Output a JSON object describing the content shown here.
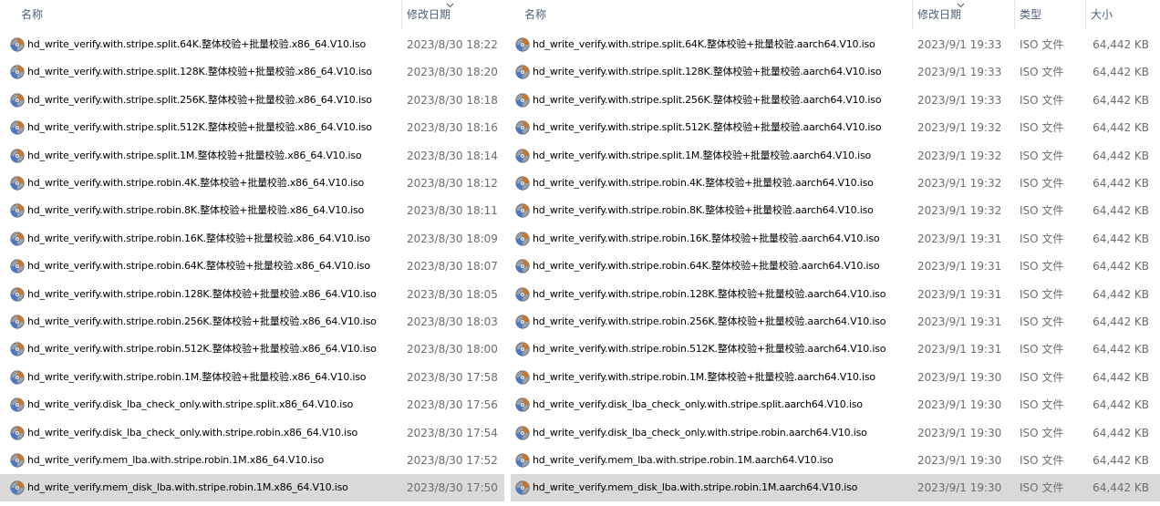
{
  "left_pane": {
    "headers": {
      "name": "名称",
      "modified": "修改日期"
    },
    "rows": [
      {
        "name": "hd_write_verify.with.stripe.split.64K.整体校验+批量校验.x86_64.V10.iso",
        "modified": "2023/8/30 18:22"
      },
      {
        "name": "hd_write_verify.with.stripe.split.128K.整体校验+批量校验.x86_64.V10.iso",
        "modified": "2023/8/30 18:20"
      },
      {
        "name": "hd_write_verify.with.stripe.split.256K.整体校验+批量校验.x86_64.V10.iso",
        "modified": "2023/8/30 18:18"
      },
      {
        "name": "hd_write_verify.with.stripe.split.512K.整体校验+批量校验.x86_64.V10.iso",
        "modified": "2023/8/30 18:16"
      },
      {
        "name": "hd_write_verify.with.stripe.split.1M.整体校验+批量校验.x86_64.V10.iso",
        "modified": "2023/8/30 18:14"
      },
      {
        "name": "hd_write_verify.with.stripe.robin.4K.整体校验+批量校验.x86_64.V10.iso",
        "modified": "2023/8/30 18:12"
      },
      {
        "name": "hd_write_verify.with.stripe.robin.8K.整体校验+批量校验.x86_64.V10.iso",
        "modified": "2023/8/30 18:11"
      },
      {
        "name": "hd_write_verify.with.stripe.robin.16K.整体校验+批量校验.x86_64.V10.iso",
        "modified": "2023/8/30 18:09"
      },
      {
        "name": "hd_write_verify.with.stripe.robin.64K.整体校验+批量校验.x86_64.V10.iso",
        "modified": "2023/8/30 18:07"
      },
      {
        "name": "hd_write_verify.with.stripe.robin.128K.整体校验+批量校验.x86_64.V10.iso",
        "modified": "2023/8/30 18:05"
      },
      {
        "name": "hd_write_verify.with.stripe.robin.256K.整体校验+批量校验.x86_64.V10.iso",
        "modified": "2023/8/30 18:03"
      },
      {
        "name": "hd_write_verify.with.stripe.robin.512K.整体校验+批量校验.x86_64.V10.iso",
        "modified": "2023/8/30 18:00"
      },
      {
        "name": "hd_write_verify.with.stripe.robin.1M.整体校验+批量校验.x86_64.V10.iso",
        "modified": "2023/8/30 17:58"
      },
      {
        "name": "hd_write_verify.disk_lba_check_only.with.stripe.split.x86_64.V10.iso",
        "modified": "2023/8/30 17:56"
      },
      {
        "name": "hd_write_verify.disk_lba_check_only.with.stripe.robin.x86_64.V10.iso",
        "modified": "2023/8/30 17:54"
      },
      {
        "name": "hd_write_verify.mem_lba.with.stripe.robin.1M.x86_64.V10.iso",
        "modified": "2023/8/30 17:52"
      },
      {
        "name": "hd_write_verify.mem_disk_lba.with.stripe.robin.1M.x86_64.V10.iso",
        "modified": "2023/8/30 17:50"
      }
    ]
  },
  "right_pane": {
    "headers": {
      "name": "名称",
      "modified": "修改日期",
      "type": "类型",
      "size": "大小"
    },
    "rows": [
      {
        "name": "hd_write_verify.with.stripe.split.64K.整体校验+批量校验.aarch64.V10.iso",
        "modified": "2023/9/1 19:33",
        "type": "ISO 文件",
        "size": "64,442 KB"
      },
      {
        "name": "hd_write_verify.with.stripe.split.128K.整体校验+批量校验.aarch64.V10.iso",
        "modified": "2023/9/1 19:33",
        "type": "ISO 文件",
        "size": "64,442 KB"
      },
      {
        "name": "hd_write_verify.with.stripe.split.256K.整体校验+批量校验.aarch64.V10.iso",
        "modified": "2023/9/1 19:33",
        "type": "ISO 文件",
        "size": "64,442 KB"
      },
      {
        "name": "hd_write_verify.with.stripe.split.512K.整体校验+批量校验.aarch64.V10.iso",
        "modified": "2023/9/1 19:32",
        "type": "ISO 文件",
        "size": "64,442 KB"
      },
      {
        "name": "hd_write_verify.with.stripe.split.1M.整体校验+批量校验.aarch64.V10.iso",
        "modified": "2023/9/1 19:32",
        "type": "ISO 文件",
        "size": "64,442 KB"
      },
      {
        "name": "hd_write_verify.with.stripe.robin.4K.整体校验+批量校验.aarch64.V10.iso",
        "modified": "2023/9/1 19:32",
        "type": "ISO 文件",
        "size": "64,442 KB"
      },
      {
        "name": "hd_write_verify.with.stripe.robin.8K.整体校验+批量校验.aarch64.V10.iso",
        "modified": "2023/9/1 19:32",
        "type": "ISO 文件",
        "size": "64,442 KB"
      },
      {
        "name": "hd_write_verify.with.stripe.robin.16K.整体校验+批量校验.aarch64.V10.iso",
        "modified": "2023/9/1 19:31",
        "type": "ISO 文件",
        "size": "64,442 KB"
      },
      {
        "name": "hd_write_verify.with.stripe.robin.64K.整体校验+批量校验.aarch64.V10.iso",
        "modified": "2023/9/1 19:31",
        "type": "ISO 文件",
        "size": "64,442 KB"
      },
      {
        "name": "hd_write_verify.with.stripe.robin.128K.整体校验+批量校验.aarch64.V10.iso",
        "modified": "2023/9/1 19:31",
        "type": "ISO 文件",
        "size": "64,442 KB"
      },
      {
        "name": "hd_write_verify.with.stripe.robin.256K.整体校验+批量校验.aarch64.V10.iso",
        "modified": "2023/9/1 19:31",
        "type": "ISO 文件",
        "size": "64,442 KB"
      },
      {
        "name": "hd_write_verify.with.stripe.robin.512K.整体校验+批量校验.aarch64.V10.iso",
        "modified": "2023/9/1 19:31",
        "type": "ISO 文件",
        "size": "64,442 KB"
      },
      {
        "name": "hd_write_verify.with.stripe.robin.1M.整体校验+批量校验.aarch64.V10.iso",
        "modified": "2023/9/1 19:30",
        "type": "ISO 文件",
        "size": "64,442 KB"
      },
      {
        "name": "hd_write_verify.disk_lba_check_only.with.stripe.split.aarch64.V10.iso",
        "modified": "2023/9/1 19:30",
        "type": "ISO 文件",
        "size": "64,442 KB"
      },
      {
        "name": "hd_write_verify.disk_lba_check_only.with.stripe.robin.aarch64.V10.iso",
        "modified": "2023/9/1 19:30",
        "type": "ISO 文件",
        "size": "64,442 KB"
      },
      {
        "name": "hd_write_verify.mem_lba.with.stripe.robin.1M.aarch64.V10.iso",
        "modified": "2023/9/1 19:30",
        "type": "ISO 文件",
        "size": "64,442 KB"
      },
      {
        "name": "hd_write_verify.mem_disk_lba.with.stripe.robin.1M.aarch64.V10.iso",
        "modified": "2023/9/1 19:30",
        "type": "ISO 文件",
        "size": "64,442 KB"
      }
    ]
  },
  "file_icon": "disc-image-icon",
  "sort_indicator_icon": "sort-chevron-down-icon",
  "selected_row_index": 16,
  "colors": {
    "header_text": "#4c607a",
    "name_text": "#000000",
    "meta_text": "#6d6d6d",
    "selected_row": "#d9d9d9"
  }
}
